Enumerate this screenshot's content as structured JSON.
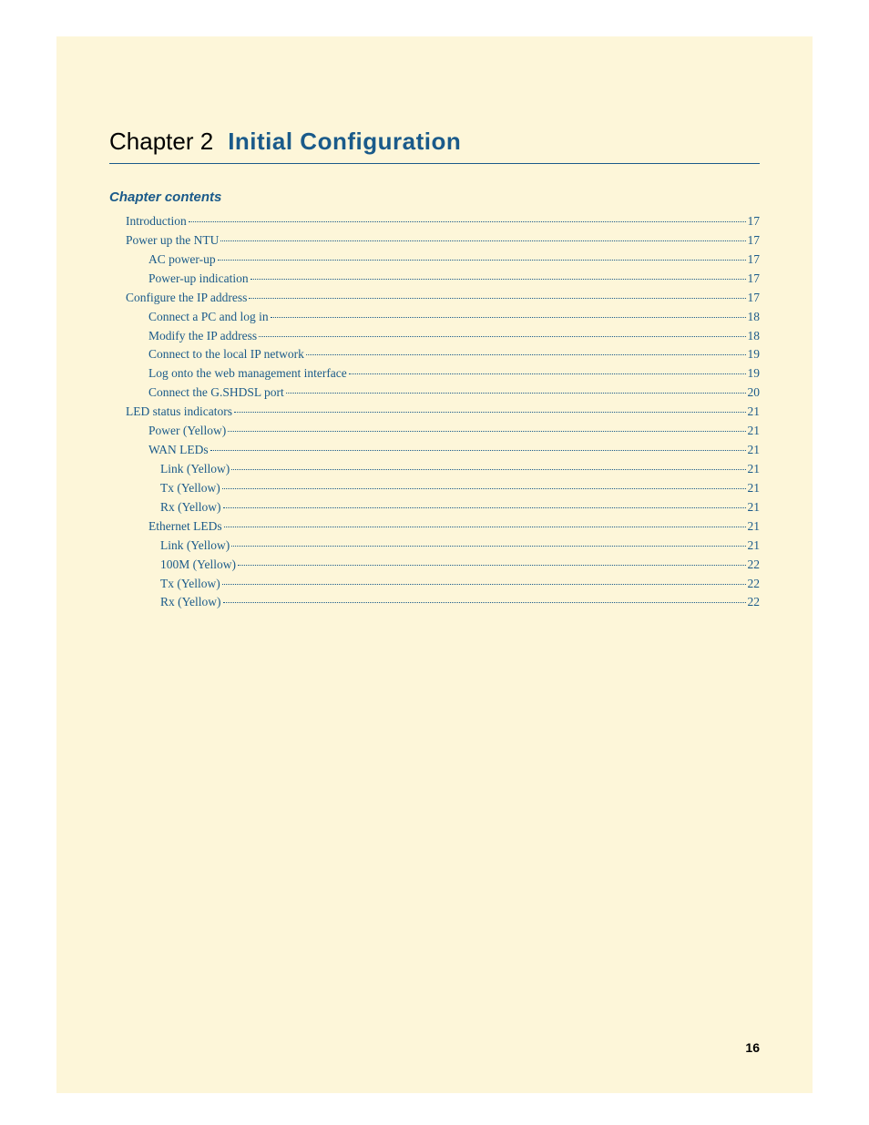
{
  "chapter": {
    "number_label": "Chapter 2",
    "title": "Initial Configuration"
  },
  "section_heading": "Chapter contents",
  "toc": [
    {
      "label": "Introduction",
      "page": "17",
      "indent": 0
    },
    {
      "label": "Power up the NTU ",
      "page": "17",
      "indent": 0
    },
    {
      "label": "AC power-up ",
      "page": "17",
      "indent": 1
    },
    {
      "label": "Power-up indication ",
      "page": "17",
      "indent": 1
    },
    {
      "label": "Configure the IP address",
      "page": "17",
      "indent": 0
    },
    {
      "label": "Connect a PC and log in ",
      "page": "18",
      "indent": 1
    },
    {
      "label": "Modify the IP address ",
      "page": "18",
      "indent": 1
    },
    {
      "label": "Connect to the local IP network ",
      "page": "19",
      "indent": 1
    },
    {
      "label": "Log onto the web management interface ",
      "page": "19",
      "indent": 1
    },
    {
      "label": "Connect the G.SHDSL port ",
      "page": "20",
      "indent": 1
    },
    {
      "label": "LED status indicators ",
      "page": "21",
      "indent": 0
    },
    {
      "label": "Power (Yellow) ",
      "page": "21",
      "indent": 1
    },
    {
      "label": "WAN LEDs ",
      "page": "21",
      "indent": 1
    },
    {
      "label": "Link (Yellow) ",
      "page": "21",
      "indent": 2
    },
    {
      "label": "Tx (Yellow) ",
      "page": "21",
      "indent": 2
    },
    {
      "label": "Rx (Yellow) ",
      "page": "21",
      "indent": 2
    },
    {
      "label": "Ethernet LEDs ",
      "page": "21",
      "indent": 1
    },
    {
      "label": "Link (Yellow) ",
      "page": "21",
      "indent": 2
    },
    {
      "label": "100M (Yellow) ",
      "page": "22",
      "indent": 2
    },
    {
      "label": "Tx (Yellow) ",
      "page": "22",
      "indent": 2
    },
    {
      "label": "Rx (Yellow) ",
      "page": "22",
      "indent": 2
    }
  ],
  "page_number": "16"
}
